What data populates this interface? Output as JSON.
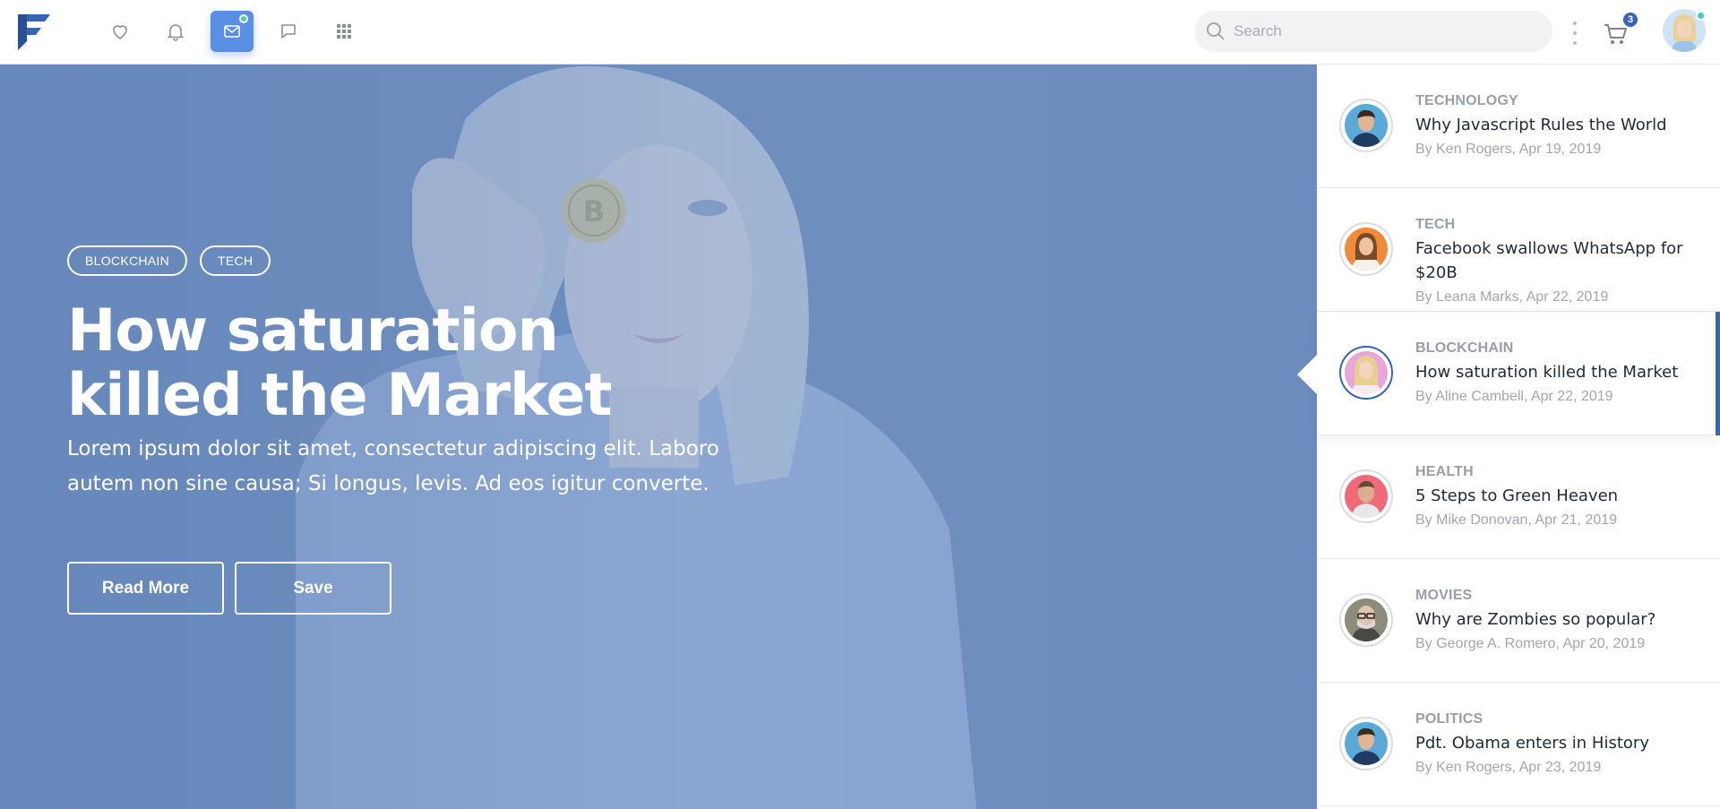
{
  "header": {
    "search_placeholder": "Search",
    "cart_count": "3",
    "accent_color": "#5b8fe6",
    "icons": [
      "heart-icon",
      "bell-icon",
      "mail-icon",
      "chat-icon",
      "apps-grid-icon"
    ]
  },
  "hero": {
    "tags": [
      "BLOCKCHAIN",
      "TECH"
    ],
    "title_line1": "How saturation",
    "title_line2": "killed the Market",
    "description": "Lorem ipsum dolor sit amet, consectetur adipiscing elit. Laboro autem non sine causa; Si longus, levis. Ad eos igitur converte.",
    "read_more_label": "Read More",
    "save_label": "Save"
  },
  "articles": [
    {
      "category": "TECHNOLOGY",
      "title": "Why Javascript Rules the World",
      "meta": "By Ken Rogers, Apr 19, 2019",
      "avatar_color": "#5aa9d8"
    },
    {
      "category": "TECH",
      "title": "Facebook swallows WhatsApp for $20B",
      "meta": "By Leana Marks, Apr 22, 2019",
      "avatar_color": "#f08a3c"
    },
    {
      "category": "BLOCKCHAIN",
      "title": "How saturation killed the Market",
      "meta": "By Aline Cambell, Apr 22, 2019",
      "avatar_color": "#e9a6d8",
      "active": true
    },
    {
      "category": "HEALTH",
      "title": "5 Steps to Green Heaven",
      "meta": "By Mike Donovan, Apr 21, 2019",
      "avatar_color": "#f06a7a"
    },
    {
      "category": "MOVIES",
      "title": "Why are Zombies so popular?",
      "meta": "By George A. Romero, Apr 20, 2019",
      "avatar_color": "#8c8c7a"
    },
    {
      "category": "POLITICS",
      "title": "Pdt. Obama enters in History",
      "meta": "By Ken Rogers, Apr 23, 2019",
      "avatar_color": "#5aa9d8"
    }
  ]
}
